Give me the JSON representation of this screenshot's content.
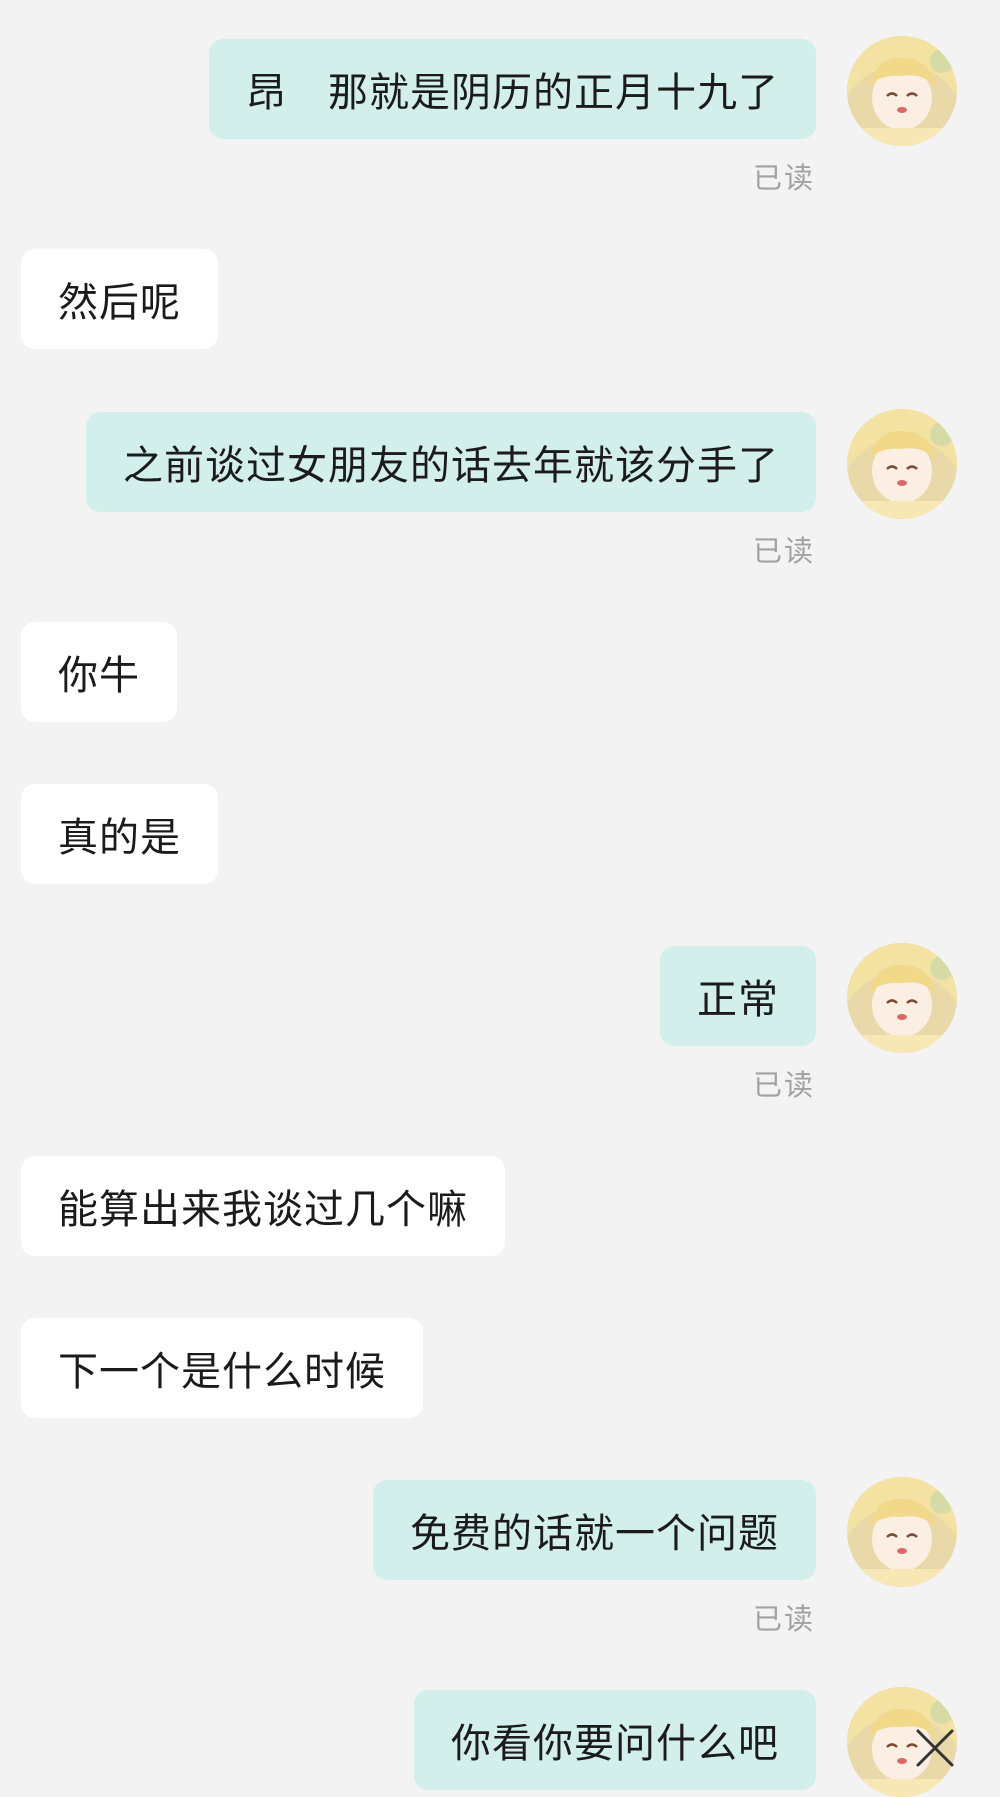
{
  "messages": [
    {
      "side": "out",
      "text": "昂　那就是阴历的正月十九了",
      "read": "已读"
    },
    {
      "side": "in",
      "text": "然后呢"
    },
    {
      "side": "out",
      "text": "之前谈过女朋友的话去年就该分手了",
      "read": "已读"
    },
    {
      "side": "in",
      "text": "你牛"
    },
    {
      "side": "in",
      "text": "真的是"
    },
    {
      "side": "out",
      "text": "正常",
      "read": "已读"
    },
    {
      "side": "in",
      "text": "能算出来我谈过几个嘛"
    },
    {
      "side": "in",
      "text": "下一个是什么时候"
    },
    {
      "side": "out",
      "text": "免费的话就一个问题",
      "read": "已读"
    },
    {
      "side": "out",
      "text": "你看你要问什么吧"
    }
  ],
  "colors": {
    "background": "#f3f3f3",
    "outgoing_bubble": "#d3efec",
    "incoming_bubble": "#ffffff",
    "read_receipt": "#a2a2a2"
  },
  "icons": {
    "avatar": "anime-girl-avatar",
    "close": "close-icon"
  }
}
